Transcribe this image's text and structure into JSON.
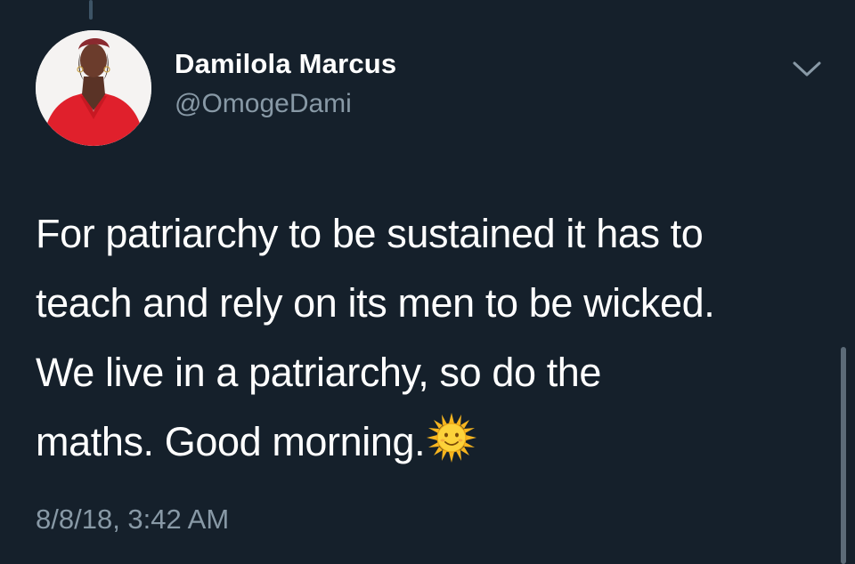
{
  "tweet": {
    "author": {
      "display_name": "Damilola Marcus",
      "handle": "@OmogeDami"
    },
    "text_lines": [
      "For patriarchy to be sustained it has to",
      "teach and rely on its men to be wicked.",
      "We live in a patriarchy, so do the",
      "maths. Good morning."
    ],
    "emoji": "sun-with-face-icon",
    "timestamp": "8/8/18, 3:42 AM"
  },
  "colors": {
    "background": "#15202b",
    "primary_text": "#ffffff",
    "secondary_text": "#8899a6"
  }
}
